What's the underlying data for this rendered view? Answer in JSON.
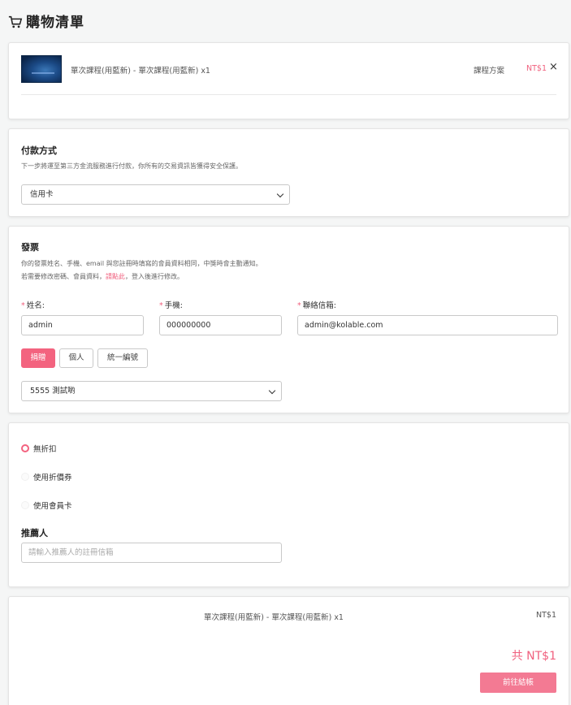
{
  "page": {
    "title": "購物清單"
  },
  "cart": {
    "item_name": "單次課程(用藍新) - 單次課程(用藍新) x1",
    "plan_label": "課程方案",
    "price": "NT$1",
    "remove": "×"
  },
  "payment": {
    "title": "付款方式",
    "hint": "下一步將運至第三方金流服務進行付款，你所有的交易資訊皆獲得安全保護。",
    "selected": "信用卡"
  },
  "invoice": {
    "title": "發票",
    "hint_line1": "你的發票姓名、手機、email 與您註冊時填寫的會員資料相同，中獎時會主動通知。",
    "hint_line2_prefix": "若需要修改密碼、會員資料，",
    "hint_link": "請點此",
    "hint_line2_suffix": "，登入後進行修改。",
    "name_label": "姓名:",
    "phone_label": "手機:",
    "email_label": "聯絡信箱:",
    "required_mark": "*",
    "name_value": "admin",
    "phone_value": "000000000",
    "email_value": "admin@kolable.com",
    "type_buttons": [
      "捐贈",
      "個人",
      "統一編號"
    ],
    "donation_selected": "5555 測試喲"
  },
  "discount": {
    "options": [
      "無折扣",
      "使用折價券",
      "使用會員卡"
    ],
    "selected_index": 0,
    "referrer_title": "推薦人",
    "referrer_placeholder": "請輸入推薦人的註冊信箱"
  },
  "summary": {
    "line": "單次課程(用藍新) - 單次課程(用藍新) x1",
    "line_price": "NT$1",
    "total": "共 NT$1",
    "checkout": "前往結帳"
  },
  "colors": {
    "accent": "#f3637f",
    "background": "#f5f6f6"
  }
}
